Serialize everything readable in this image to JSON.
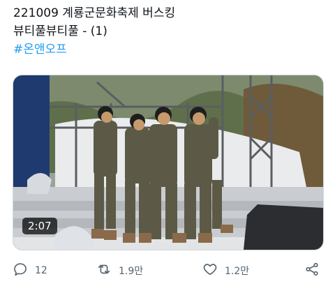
{
  "tweet": {
    "line1": "221009 계룡군문화축제 버스킹",
    "line2": "뷰티풀뷰티풀 - (1)",
    "hashtag": "#온앤오프"
  },
  "media": {
    "duration": "2:07"
  },
  "actions": {
    "replies": "12",
    "retweets": "1.9만",
    "likes": "1.2만"
  },
  "icons": [
    "reply-icon",
    "retweet-icon",
    "like-icon",
    "share-icon"
  ],
  "colors": {
    "hashtag": "#1d9bf0",
    "action": "#536471",
    "text": "#0f1419"
  }
}
